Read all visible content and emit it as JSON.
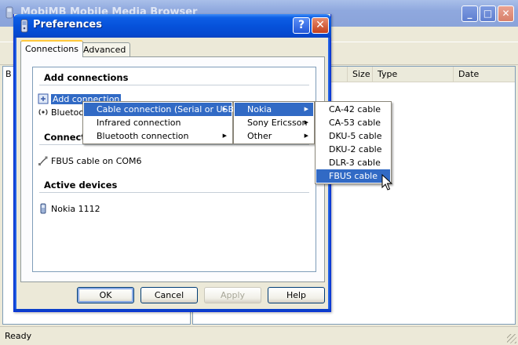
{
  "main_window": {
    "title": "MobiMB Mobile Media Browser",
    "minimize_glyph": "_",
    "maximize_glyph": "□",
    "close_glyph": "✕",
    "columns": [
      "Size",
      "Type",
      "Date"
    ],
    "status": "Ready",
    "left_pane_letter": "B"
  },
  "dialog": {
    "title": "Preferences",
    "help_glyph": "?",
    "close_glyph": "✕",
    "tabs": [
      {
        "label": "Connections",
        "active": true
      },
      {
        "label": "Advanced",
        "active": false
      }
    ],
    "sections": {
      "add": {
        "header": "Add connections",
        "items": [
          {
            "label": "Add connection",
            "icon": "add-connection-icon",
            "selected": true
          },
          {
            "label": "Bluetooth",
            "icon": "bluetooth-icon",
            "selected": false
          }
        ]
      },
      "connections": {
        "header": "Connections",
        "items": [
          {
            "label": "FBUS cable on COM6",
            "icon": "cable-icon"
          }
        ]
      },
      "active": {
        "header": "Active devices",
        "items": [
          {
            "label": "Nokia 1112",
            "icon": "phone-icon"
          }
        ]
      }
    },
    "buttons": {
      "ok": "OK",
      "cancel": "Cancel",
      "apply": "Apply",
      "help": "Help"
    }
  },
  "menus": {
    "connection_type": [
      {
        "label": "Cable connection (Serial or USB)",
        "submenu": true,
        "highlighted": true
      },
      {
        "label": "Infrared connection",
        "submenu": false,
        "highlighted": false
      },
      {
        "label": "Bluetooth connection",
        "submenu": true,
        "highlighted": false
      }
    ],
    "manufacturer": [
      {
        "label": "Nokia",
        "submenu": true,
        "highlighted": true
      },
      {
        "label": "Sony Ericsson",
        "submenu": true,
        "highlighted": false
      },
      {
        "label": "Other",
        "submenu": true,
        "highlighted": false
      }
    ],
    "cable": [
      {
        "label": "CA-42 cable",
        "highlighted": false
      },
      {
        "label": "CA-53 cable",
        "highlighted": false
      },
      {
        "label": "DKU-5 cable",
        "highlighted": false
      },
      {
        "label": "DKU-2 cable",
        "highlighted": false
      },
      {
        "label": "DLR-3 cable",
        "highlighted": false
      },
      {
        "label": "FBUS cable",
        "highlighted": true
      }
    ],
    "arrow_glyph": "▶"
  },
  "colors": {
    "highlight": "#316ac5",
    "dialog_title": "#0652db",
    "xp_face": "#ece9d8"
  }
}
